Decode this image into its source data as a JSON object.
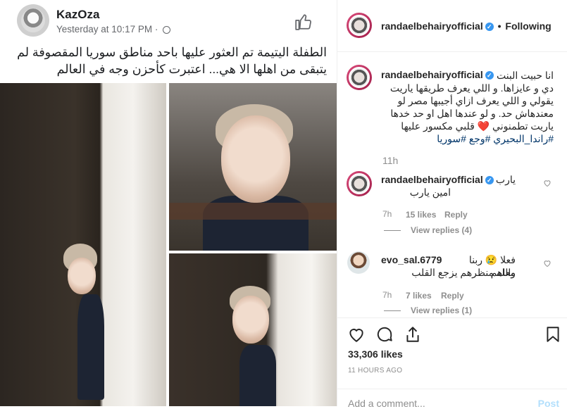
{
  "facebook": {
    "author": "KazOza",
    "timestamp": "Yesterday at 10:17 PM",
    "separator": "·",
    "post_text": "الطفلة اليتيمة تم العثور عليها باحد مناطق سوريا المقصوفة لم يتبقى من اهلها الا هي... اعتبرت كأحزن وجه في العالم"
  },
  "instagram": {
    "header": {
      "username": "randaelbehairyofficial",
      "dot": "•",
      "follow_state": "Following"
    },
    "caption": {
      "username": "randaelbehairyofficial",
      "lines": [
        "انا حبيت البنت",
        "دي و عايزاها. و اللي يعرف طريقها ياريت",
        "يقولي و اللي يعرف ازاي أجيبها مصر لو",
        "معندهاش حد. و لو عندها اهل او حد خدها",
        "ياريت تطمنوني ❤️ قلبي مكسور عليها"
      ],
      "hashtags": "#راندا_البحيري #وجع #سوريا",
      "age": "11h"
    },
    "comments": [
      {
        "username": "randaelbehairyofficial",
        "text_line1": "يارب",
        "text_line2": "امين يارب",
        "age": "7h",
        "likes": "15 likes",
        "reply": "Reply",
        "view_replies": "View replies (4)"
      },
      {
        "username": "evo_sal.6779",
        "text_line1": "فعلا 😢 ربنا معاهم",
        "text_line2": "والله منظرهم يزجع القلب",
        "age": "7h",
        "likes": "7 likes",
        "reply": "Reply",
        "view_replies": "View replies (1)"
      }
    ],
    "likes_count": "33,306 likes",
    "posted_ago": "11 HOURS AGO",
    "add_comment_placeholder": "Add a comment...",
    "post_button": "Post",
    "icons": [
      "heart-icon",
      "comment-icon",
      "share-icon",
      "bookmark-icon"
    ]
  }
}
